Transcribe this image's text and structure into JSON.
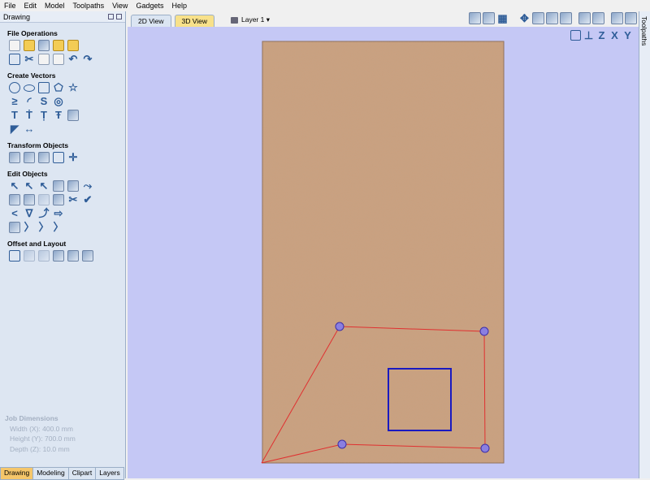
{
  "menu": [
    "File",
    "Edit",
    "Model",
    "Toolpaths",
    "View",
    "Gadgets",
    "Help"
  ],
  "panel": {
    "title": "Drawing",
    "sections": [
      {
        "title": "File Operations"
      },
      {
        "title": "Create Vectors"
      },
      {
        "title": "Transform Objects"
      },
      {
        "title": "Edit Objects"
      },
      {
        "title": "Offset and Layout"
      }
    ]
  },
  "job": {
    "title": "Job Dimensions",
    "width": "Width  (X): 400.0 mm",
    "height": "Height (Y): 700.0 mm",
    "depth": "Depth  (Z): 10.0 mm"
  },
  "bottom_tabs": [
    "Drawing",
    "Modeling",
    "Clipart",
    "Layers"
  ],
  "view_tabs": [
    "2D View",
    "3D View"
  ],
  "layer": "Layer 1 ▾",
  "right_tab": "Toolpaths",
  "canvas_tool_labels": [
    "Z",
    "X",
    "Y"
  ],
  "colors": {
    "canvas_bg": "#c5c8f5",
    "material": "#caa07f",
    "toolpath_line": "#e03030",
    "vector": "#1a1ac0",
    "marker": "#8a7fe0"
  }
}
